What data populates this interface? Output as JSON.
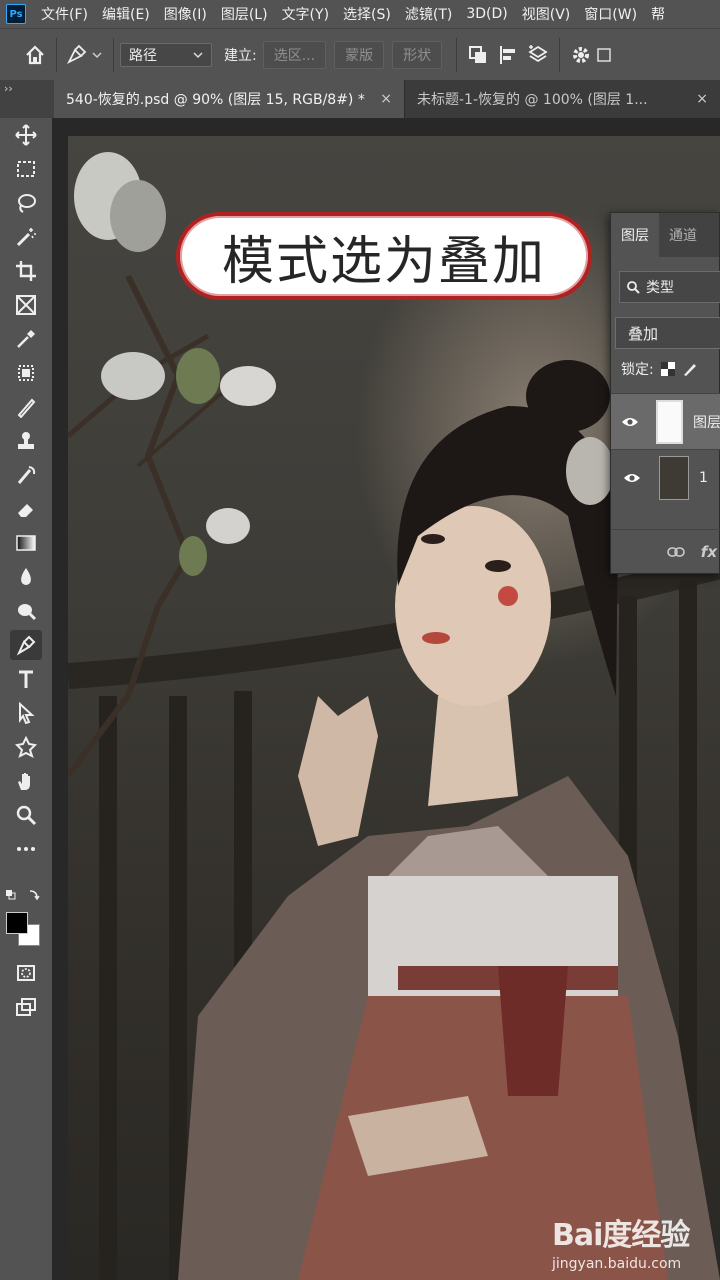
{
  "menubar": {
    "logo": "Ps",
    "items": [
      "文件(F)",
      "编辑(E)",
      "图像(I)",
      "图层(L)",
      "文字(Y)",
      "选择(S)",
      "滤镜(T)",
      "3D(D)",
      "视图(V)",
      "窗口(W)",
      "帮"
    ]
  },
  "options": {
    "mode_select": "路径",
    "make_label": "建立:",
    "selection_btn": "选区...",
    "mask_btn": "蒙版",
    "shape_btn": "形状"
  },
  "tabs": [
    {
      "label": "540-恢复的.psd @ 90% (图层 15, RGB/8#) *",
      "close": "×"
    },
    {
      "label": "未标题-1-恢复的 @ 100% (图层 1...",
      "close": "×"
    }
  ],
  "annotation": {
    "text": "模式选为叠加",
    "border_color": "#b02222"
  },
  "layers_panel": {
    "tabs": [
      "图层",
      "通道"
    ],
    "filter": "类型",
    "blend_mode": "叠加",
    "lock_label": "锁定:",
    "layers": [
      {
        "name": "图层",
        "selected": true
      },
      {
        "name": "1",
        "selected": false
      }
    ],
    "footer_fx": "fx"
  },
  "watermark": {
    "logo": "Bai度经验",
    "url": "jingyan.baidu.com"
  },
  "icons": [
    "home-icon",
    "pen-icon",
    "move-icon",
    "marquee-icon",
    "lasso-icon",
    "magic-wand-icon",
    "crop-icon",
    "frame-icon",
    "eyedropper-icon",
    "patch-icon",
    "brush-icon",
    "stamp-icon",
    "history-brush-icon",
    "eraser-icon",
    "gradient-icon",
    "blur-icon",
    "dodge-icon",
    "pen-tool-icon",
    "type-icon",
    "path-select-icon",
    "shape-icon",
    "hand-icon",
    "zoom-icon",
    "more-icon",
    "quick-mask-icon",
    "screen-mode-icon",
    "eye-icon",
    "link-icon",
    "settings-icon"
  ]
}
